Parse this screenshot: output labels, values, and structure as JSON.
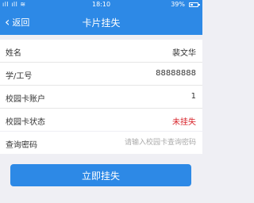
{
  "status_bar": {
    "signal": "ıll ıll ≋",
    "time": "18:10",
    "battery_pct": "39%"
  },
  "nav": {
    "back_label": "返回",
    "title": "卡片挂失"
  },
  "info_rows": [
    {
      "label": "姓名",
      "value": "裴文华"
    },
    {
      "label": "学/工号",
      "value": "88888888"
    },
    {
      "label": "校园卡账户",
      "value": "1"
    },
    {
      "label": "校园卡状态",
      "value": "未挂失"
    }
  ],
  "password": {
    "label": "查询密码",
    "placeholder": "请输入校园卡查询密码",
    "value": ""
  },
  "submit_label": "立即挂失",
  "colors": {
    "primary": "#2d89e6",
    "status_red": "#d8232a"
  }
}
